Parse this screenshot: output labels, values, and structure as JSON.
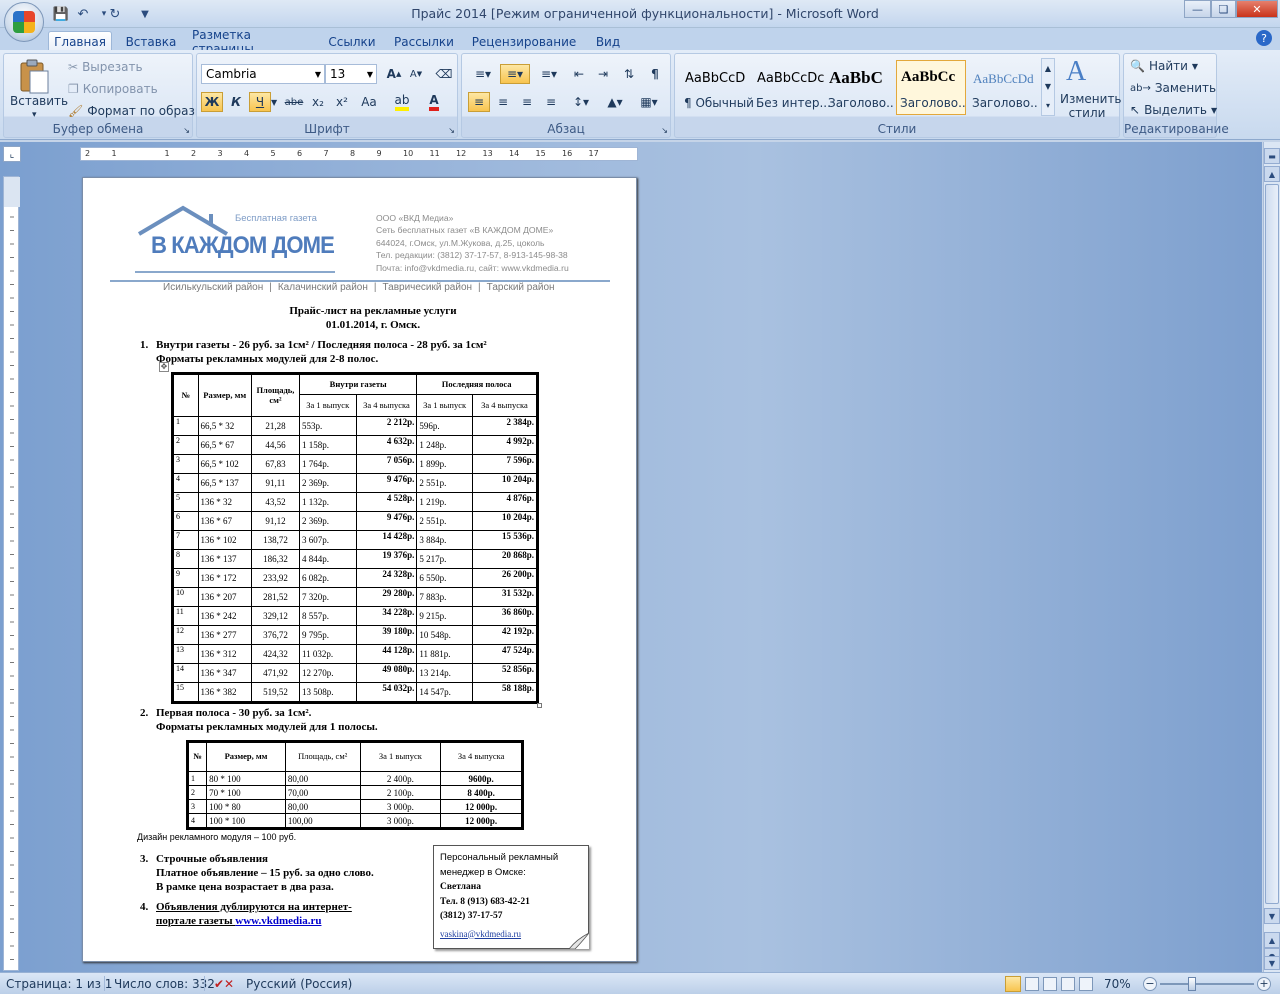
{
  "window": {
    "title": "Прайс 2014 [Режим ограниченной функциональности] - Microsoft Word",
    "min_icon": "minimize-icon",
    "max_icon": "maximize-icon",
    "close_icon": "close-icon"
  },
  "quick_access": [
    "save-icon",
    "undo-icon",
    "redo-icon",
    "customize-qat-icon"
  ],
  "tabs": [
    "Главная",
    "Вставка",
    "Разметка страницы",
    "Ссылки",
    "Рассылки",
    "Рецензирование",
    "Вид"
  ],
  "ribbon": {
    "clipboard": {
      "label": "Буфер обмена",
      "paste": "Вставить",
      "cut": "Вырезать",
      "copy": "Копировать",
      "format_painter": "Формат по образцу"
    },
    "font": {
      "label": "Шрифт",
      "font_name": "Cambria",
      "font_size": "13",
      "bold": "Ж",
      "italic": "К",
      "underline": "Ч",
      "strike": "abe",
      "sub": "x₂",
      "sup": "x²",
      "case": "Aa"
    },
    "paragraph": {
      "label": "Абзац"
    },
    "styles": {
      "label": "Стили",
      "items": [
        {
          "sample": "AaBbCcD",
          "name": "¶ Обычный"
        },
        {
          "sample": "AaBbCcDc",
          "name": "Без интер..."
        },
        {
          "sample": "AaBbC",
          "name": "Заголово..."
        },
        {
          "sample": "AaBbCc",
          "name": "Заголово..."
        },
        {
          "sample": "AaBbCcDd",
          "name": "Заголово..."
        }
      ],
      "change_styles": "Изменить стили"
    },
    "editing": {
      "label": "Редактирование",
      "find": "Найти",
      "replace": "Заменить",
      "select": "Выделить"
    }
  },
  "ruler": {
    "marks": [
      "2",
      "1",
      "",
      "1",
      "2",
      "3",
      "4",
      "5",
      "6",
      "7",
      "8",
      "9",
      "10",
      "11",
      "12",
      "13",
      "14",
      "15",
      "16",
      "17"
    ]
  },
  "document": {
    "header": {
      "small_caption": "Бесплатная газета",
      "logo_text": "В КАЖДОМ ДОМЕ",
      "company_lines": [
        "ООО «ВКД Медиа»",
        "Сеть бесплатных газет «В КАЖДОМ ДОМЕ»",
        "644024, г.Омск, ул.М.Жукова, д.25, цоколь",
        "Тел. редакции: (3812) 37-17-57, 8-913-145-98-38",
        "Почта: info@vkdmedia.ru, сайт: www.vkdmedia.ru"
      ],
      "districts": [
        "Исилькульский район",
        "Калачинский район",
        "Тавричесикй район",
        "Тарский район"
      ]
    },
    "title_line1": "Прайс-лист на рекламные услуги",
    "title_line2": "01.01.2014, г. Омск.",
    "section1": {
      "num": "1.",
      "line1": "Внутри газеты - 26 руб. за 1см² / Последняя полоса - 28 руб. за 1см²",
      "line2": "Форматы рекламных  модулей для 2-8 полос.",
      "headers": {
        "num": "№",
        "size": "Размер, мм",
        "area": "Площадь, см²",
        "inside": "Внутри газеты",
        "last": "Последняя полоса",
        "one": "За 1 выпуск",
        "four": "За 4 выпуска"
      },
      "rows": [
        [
          "1",
          "66,5 * 32",
          "21,28",
          "553р.",
          "2 212р.",
          "596р.",
          "2 384р."
        ],
        [
          "2",
          "66,5 * 67",
          "44,56",
          "1 158р.",
          "4 632р.",
          "1 248р.",
          "4 992р."
        ],
        [
          "3",
          "66,5 * 102",
          "67,83",
          "1 764р.",
          "7 056р.",
          "1 899р.",
          "7 596р."
        ],
        [
          "4",
          "66,5 * 137",
          "91,11",
          "2 369р.",
          "9 476р.",
          "2 551р.",
          "10 204р."
        ],
        [
          "5",
          "136 * 32",
          "43,52",
          "1 132р.",
          "4 528р.",
          "1 219р.",
          "4 876р."
        ],
        [
          "6",
          "136 * 67",
          "91,12",
          "2 369р.",
          "9 476р.",
          "2 551р.",
          "10 204р."
        ],
        [
          "7",
          "136 * 102",
          "138,72",
          "3 607р.",
          "14 428р.",
          "3 884р.",
          "15 536р."
        ],
        [
          "8",
          "136 * 137",
          "186,32",
          "4 844р.",
          "19 376р.",
          "5 217р.",
          "20 868р."
        ],
        [
          "9",
          "136 * 172",
          "233,92",
          "6 082р.",
          "24 328р.",
          "6 550р.",
          "26 200р."
        ],
        [
          "10",
          "136 * 207",
          "281,52",
          "7 320р.",
          "29 280р.",
          "7 883р.",
          "31 532р."
        ],
        [
          "11",
          "136 * 242",
          "329,12",
          "8 557р.",
          "34 228р.",
          "9 215р.",
          "36 860р."
        ],
        [
          "12",
          "136 * 277",
          "376,72",
          "9 795р.",
          "39 180р.",
          "10 548р.",
          "42 192р."
        ],
        [
          "13",
          "136 * 312",
          "424,32",
          "11 032р.",
          "44 128р.",
          "11 881р.",
          "47 524р."
        ],
        [
          "14",
          "136 * 347",
          "471,92",
          "12 270р.",
          "49 080р.",
          "13 214р.",
          "52 856р."
        ],
        [
          "15",
          "136 * 382",
          "519,52",
          "13 508р.",
          "54 032р.",
          "14 547р.",
          "58 188р."
        ]
      ]
    },
    "section2": {
      "num": "2.",
      "line1": "Первая полоса - 30 руб. за 1см².",
      "line2": "Форматы рекламных  модулей для 1 полосы.",
      "headers": {
        "num": "№",
        "size": "Размер, мм",
        "area": "Площадь, см²",
        "one": "За 1 выпуск",
        "four": "За 4 выпуска"
      },
      "rows": [
        [
          "1",
          "80 * 100",
          "80,00",
          "2 400р.",
          "9600р."
        ],
        [
          "2",
          "70 * 100",
          "70,00",
          "2 100р.",
          "8 400р."
        ],
        [
          "3",
          "100 * 80",
          "80,00",
          "3 000р.",
          "12 000р."
        ],
        [
          "4",
          "100 * 100",
          "100,00",
          "3 000р.",
          "12 000р."
        ]
      ],
      "design_note": "Дизайн рекламного модуля – 100 руб."
    },
    "section3": {
      "num": "3.",
      "line1": "Строчные объявления",
      "line2": "Платное объявление – 15 руб. за одно слово.",
      "line3": "В рамке цена возрастает в два раза."
    },
    "section4": {
      "num": "4.",
      "line1": "Объявления дублируются на интернет-",
      "line2_prefix": "портале газеты  ",
      "link": "www.vkdmedia.ru"
    },
    "note": {
      "line1": "Персональный рекламный",
      "line2": "менеджер в Омске:",
      "name": "Светлана",
      "phone1": "Тел. 8 (913) 683-42-21",
      "phone2": "(3812) 37-17-57",
      "email": "vaskina@vkdmedia.ru"
    }
  },
  "status": {
    "page": "Страница: 1 из 1",
    "words": "Число слов: 332",
    "language": "Русский (Россия)",
    "zoom": "70%"
  }
}
